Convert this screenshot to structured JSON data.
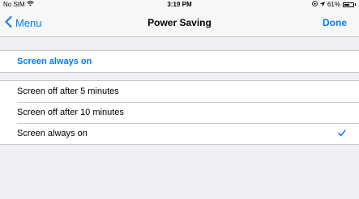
{
  "status_bar": {
    "carrier": "No SIM",
    "time": "3:19 PM",
    "battery": "61%",
    "battery_level": 0.61
  },
  "nav": {
    "back_label": "Menu",
    "title": "Power Saving",
    "done_label": "Done"
  },
  "current_setting": {
    "label": "Screen always on"
  },
  "options": [
    {
      "label": "Screen off after 5 minutes",
      "selected": false
    },
    {
      "label": "Screen off after 10 minutes",
      "selected": false
    },
    {
      "label": "Screen always on",
      "selected": true
    }
  ],
  "colors": {
    "accent": "#007aff",
    "background": "#efeff4",
    "separator": "#c8c7cc"
  },
  "icons": {
    "wifi": "wifi-icon",
    "location": "location-icon",
    "lock_rotation": "orientation-lock-icon",
    "back": "chevron-left-icon",
    "check": "checkmark-icon"
  }
}
